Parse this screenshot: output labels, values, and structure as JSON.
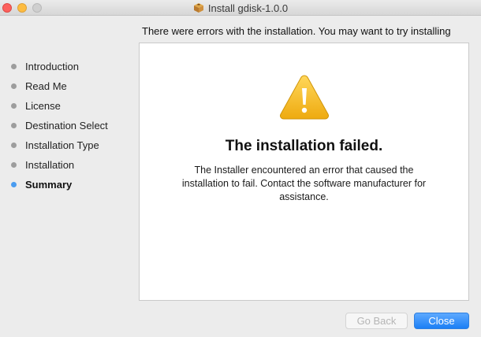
{
  "window": {
    "title": "Install gdisk-1.0.0"
  },
  "headline": "There were errors with the installation. You may want to try installing",
  "sidebar": {
    "steps": [
      {
        "label": "Introduction"
      },
      {
        "label": "Read Me"
      },
      {
        "label": "License"
      },
      {
        "label": "Destination Select"
      },
      {
        "label": "Installation Type"
      },
      {
        "label": "Installation"
      },
      {
        "label": "Summary",
        "current": true
      }
    ]
  },
  "main": {
    "icon": "warning-icon",
    "title": "The installation failed.",
    "message": "The Installer encountered an error that caused the installation to fail. Contact the software manufacturer for assistance."
  },
  "buttons": {
    "back_label": "Go Back",
    "back_enabled": false,
    "close_label": "Close"
  },
  "colors": {
    "accent": "#4a9cf0",
    "warning": "#f5c12e",
    "close_button": "#1b7ff5"
  }
}
